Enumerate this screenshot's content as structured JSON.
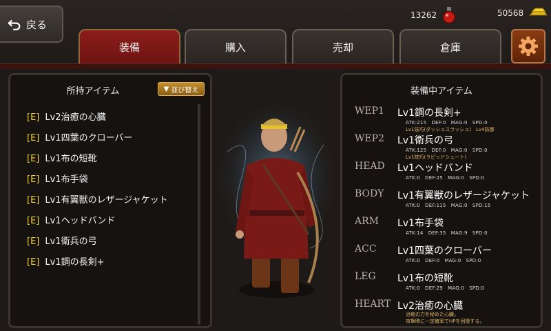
{
  "header": {
    "back_label": "戻る",
    "currency_red": "13262",
    "currency_gold": "50568",
    "tabs": [
      {
        "label": "装備",
        "active": true
      },
      {
        "label": "購入",
        "active": false
      },
      {
        "label": "売却",
        "active": false
      },
      {
        "label": "倉庫",
        "active": false
      }
    ],
    "settings_icon": "gear-icon"
  },
  "inventory": {
    "title": "所持アイテム",
    "sort_label": "並び替え",
    "items": [
      {
        "tag": "[E]",
        "name": "Lv2治癒の心臓"
      },
      {
        "tag": "[E]",
        "name": "Lv1四葉のクローバー"
      },
      {
        "tag": "[E]",
        "name": "Lv1布の短靴"
      },
      {
        "tag": "[E]",
        "name": "Lv1布手袋"
      },
      {
        "tag": "[E]",
        "name": "Lv1有翼獣のレザージャケット"
      },
      {
        "tag": "[E]",
        "name": "Lv1ヘッドバンド"
      },
      {
        "tag": "[E]",
        "name": "Lv1衛兵の弓"
      },
      {
        "tag": "[E]",
        "name": "Lv1鋼の長剣+"
      }
    ]
  },
  "equipped": {
    "title": "装備中アイテム",
    "slots": [
      {
        "slot": "WEP1",
        "name": "Lv1鋼の長剣+",
        "stats": "ATK:215　DEF:0　MAG:0　SPD:0",
        "note": "Lv1技巧(ダッシュスラッシュ)　Lv4防御"
      },
      {
        "slot": "WEP2",
        "name": "Lv1衛兵の弓",
        "stats": "ATK:125　DEF:0　MAG:0　SPD:0",
        "note": "Lv1技巧(ラピッドシュート)"
      },
      {
        "slot": "HEAD",
        "name": "Lv1ヘッドバンド",
        "stats": "ATK:0　DEF:25　MAG:0　SPD:0",
        "note": ""
      },
      {
        "slot": "BODY",
        "name": "Lv1有翼獣のレザージャケット",
        "stats": "ATK:0　DEF:115　MAG:0　SPD:15",
        "note": ""
      },
      {
        "slot": "ARM",
        "name": "Lv1布手袋",
        "stats": "ATK:14　DEF:35　MAG:9　SPD:0",
        "note": ""
      },
      {
        "slot": "ACC",
        "name": "Lv1四葉のクローバー",
        "stats": "ATK:0　DEF:0　MAG:0　SPD:0",
        "note": ""
      },
      {
        "slot": "LEG",
        "name": "Lv1布の短靴",
        "stats": "ATK:0　DEF:29　MAG:0　SPD:0",
        "note": ""
      },
      {
        "slot": "HEART",
        "name": "Lv2治癒の心臓",
        "stats": "",
        "note": "治癒の力を秘めた心臓。",
        "note2": "攻撃時に一定確率でHPを回復する。"
      }
    ]
  },
  "colors": {
    "active_tab": "#8c1d1a",
    "tag_yellow": "#f2d03a",
    "gear_orange": "#8a3c12"
  }
}
